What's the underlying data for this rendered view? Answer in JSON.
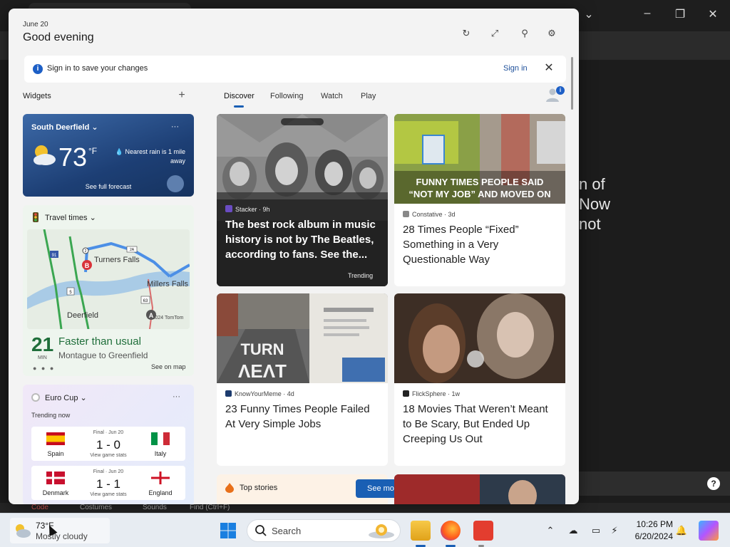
{
  "background_page": {
    "text_lines": [
      "n of",
      "Now",
      "not"
    ],
    "bottom_strip": [
      "Code",
      "Costumes",
      "Sounds",
      "Find (Ctrl+F)"
    ],
    "help_label": "?"
  },
  "panel": {
    "date": "June 20",
    "greeting": "Good evening"
  },
  "signin": {
    "message": "Sign in to save your changes",
    "link": "Sign in"
  },
  "widgets": {
    "title": "Widgets",
    "add_label": "+"
  },
  "feed_tabs": [
    {
      "label": "Discover",
      "active": true
    },
    {
      "label": "Following",
      "active": false
    },
    {
      "label": "Watch",
      "active": false
    },
    {
      "label": "Play",
      "active": false
    }
  ],
  "weather": {
    "location": "South Deerfield",
    "temperature": "73",
    "unit": "°F",
    "rain_note": "Nearest rain is 1 mile away",
    "forecast_link": "See full forecast"
  },
  "travel": {
    "title": "Travel times",
    "minutes": "21",
    "minutes_label": "MIN",
    "status": "Faster than usual",
    "route": "Montague to Greenfield",
    "see_map": "See on map",
    "map_labels": {
      "turners_falls": "Turners Falls",
      "millers_falls": "Millers Falls",
      "deerfield": "Deerfield",
      "credit": "© 2024 TomTom",
      "road_2": "2",
      "road_2a": "2A",
      "road_5": "5",
      "road_63": "63",
      "road_91": "91",
      "pin_b": "B",
      "pin_a": "A"
    }
  },
  "euro_cup": {
    "title": "Euro Cup",
    "trending": "Trending now",
    "matches": [
      {
        "status": "Final · Jun 20",
        "home": "Spain",
        "away": "Italy",
        "score": "1 - 0",
        "stats": "View game stats"
      },
      {
        "status": "Final · Jun 20",
        "home": "Denmark",
        "away": "England",
        "score": "1 - 1",
        "stats": "View game stats"
      }
    ]
  },
  "news": {
    "hero": {
      "source": "Stacker · 9h",
      "headline": "The best rock album in music history is not by The Beatles, according to fans. See the...",
      "tag": "Trending"
    },
    "cards": [
      {
        "source": "Constative · 3d",
        "headline": "28 Times People “Fixed” Something in a Very Questionable Way",
        "image_text": "FUNNY TIMES PEOPLE SAID “NOT MY JOB” AND MOVED ON",
        "logo_color": "#888888"
      },
      {
        "source": "KnowYourMeme · 4d",
        "headline": "23 Funny Times People Failed At Very Simple Jobs",
        "image_text": "T TURN",
        "logo_color": "#1c3b6e"
      },
      {
        "source": "FlickSphere · 1w",
        "headline": "18 Movies That Weren’t Meant to Be Scary, But Ended Up Creeping Us Out",
        "image_text": "",
        "logo_color": "#222222"
      }
    ],
    "top_stories": {
      "title": "Top stories",
      "button": "See more"
    }
  },
  "taskbar": {
    "temp": "73°F",
    "condition": "Mostly cloudy",
    "search_placeholder": "Search",
    "time": "10:26 PM",
    "date": "6/20/2024"
  },
  "colors": {
    "accent": "#1a5fb4",
    "travel_green": "#1f6e3a"
  }
}
